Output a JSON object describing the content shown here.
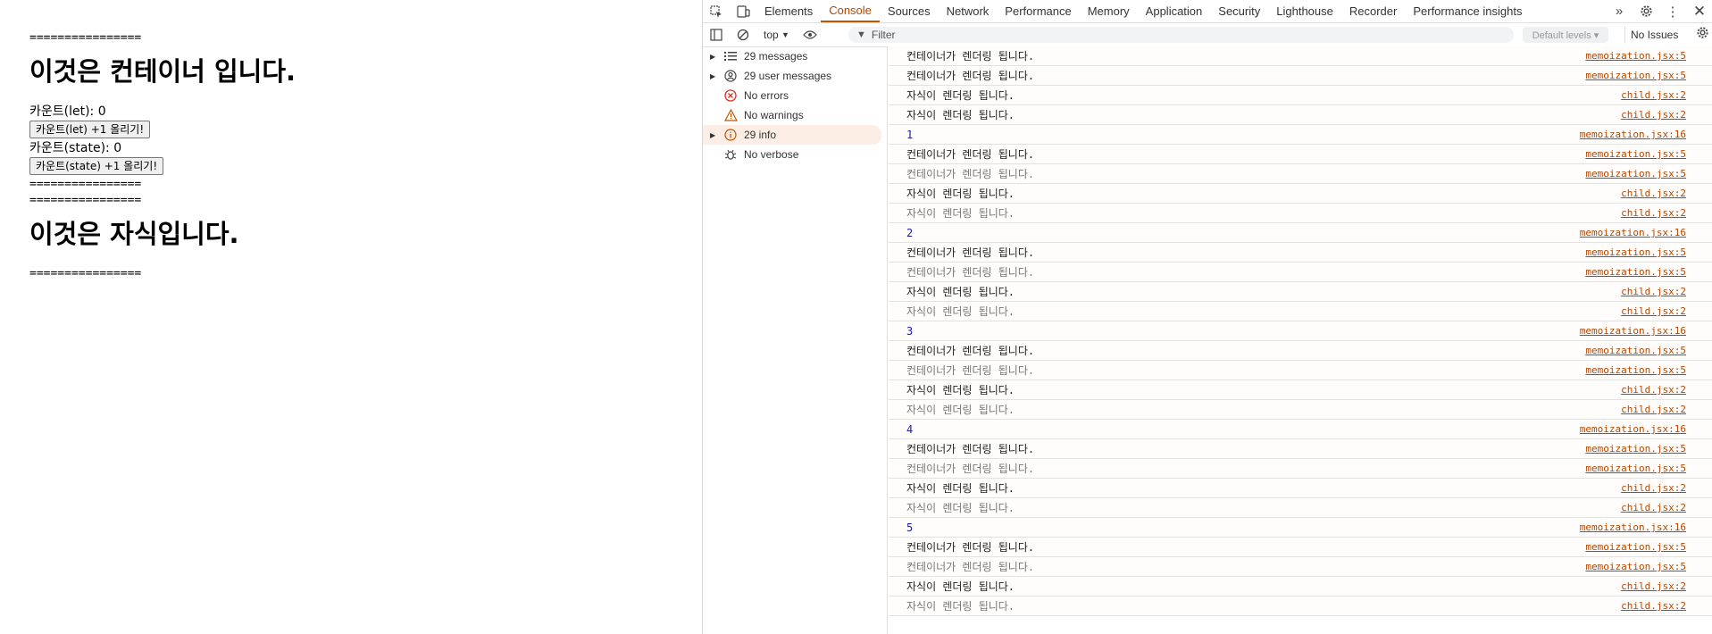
{
  "page": {
    "sep": "================",
    "container_heading": "이것은 컨테이너 입니다.",
    "count_let_label": "카운트(let): 0",
    "btn_let": "카운트(let) +1 올리기!",
    "count_state_label": "카운트(state): 0",
    "btn_state": "카운트(state) +1 올리기!",
    "child_heading": "이것은 자식입니다."
  },
  "devtools": {
    "tabs": [
      "Elements",
      "Console",
      "Sources",
      "Network",
      "Performance",
      "Memory",
      "Application",
      "Security",
      "Lighthouse",
      "Recorder",
      "Performance insights"
    ],
    "active_tab": "Console",
    "context": "top",
    "filter_placeholder": "Filter",
    "levels": "Default levels ▾",
    "issues": "No Issues",
    "sidebar": [
      {
        "label": "29 messages",
        "icon": "list-icon",
        "expandable": true
      },
      {
        "label": "29 user messages",
        "icon": "user-icon",
        "expandable": true
      },
      {
        "label": "No errors",
        "icon": "error-icon",
        "expandable": false
      },
      {
        "label": "No warnings",
        "icon": "warning-icon",
        "expandable": false
      },
      {
        "label": "29 info",
        "icon": "info-icon",
        "expandable": true
      },
      {
        "label": "No verbose",
        "icon": "bug-icon",
        "expandable": false
      }
    ],
    "messages": [
      {
        "text": "컨테이너가 렌더링 됩니다.",
        "src": "memoization.jsx:5",
        "style": "normal"
      },
      {
        "text": "컨테이너가 렌더링 됩니다.",
        "src": "memoization.jsx:5",
        "style": "normal"
      },
      {
        "text": "자식이 렌더링 됩니다.",
        "src": "child.jsx:2",
        "style": "normal"
      },
      {
        "text": "자식이 렌더링 됩니다.",
        "src": "child.jsx:2",
        "style": "normal"
      },
      {
        "text": "1",
        "src": "memoization.jsx:16",
        "style": "num"
      },
      {
        "text": "컨테이너가 렌더링 됩니다.",
        "src": "memoization.jsx:5",
        "style": "normal"
      },
      {
        "text": "컨테이너가 렌더링 됩니다.",
        "src": "memoization.jsx:5",
        "style": "dim"
      },
      {
        "text": "자식이 렌더링 됩니다.",
        "src": "child.jsx:2",
        "style": "normal"
      },
      {
        "text": "자식이 렌더링 됩니다.",
        "src": "child.jsx:2",
        "style": "dim"
      },
      {
        "text": "2",
        "src": "memoization.jsx:16",
        "style": "num"
      },
      {
        "text": "컨테이너가 렌더링 됩니다.",
        "src": "memoization.jsx:5",
        "style": "normal"
      },
      {
        "text": "컨테이너가 렌더링 됩니다.",
        "src": "memoization.jsx:5",
        "style": "dim"
      },
      {
        "text": "자식이 렌더링 됩니다.",
        "src": "child.jsx:2",
        "style": "normal"
      },
      {
        "text": "자식이 렌더링 됩니다.",
        "src": "child.jsx:2",
        "style": "dim"
      },
      {
        "text": "3",
        "src": "memoization.jsx:16",
        "style": "num"
      },
      {
        "text": "컨테이너가 렌더링 됩니다.",
        "src": "memoization.jsx:5",
        "style": "normal"
      },
      {
        "text": "컨테이너가 렌더링 됩니다.",
        "src": "memoization.jsx:5",
        "style": "dim"
      },
      {
        "text": "자식이 렌더링 됩니다.",
        "src": "child.jsx:2",
        "style": "normal"
      },
      {
        "text": "자식이 렌더링 됩니다.",
        "src": "child.jsx:2",
        "style": "dim"
      },
      {
        "text": "4",
        "src": "memoization.jsx:16",
        "style": "num"
      },
      {
        "text": "컨테이너가 렌더링 됩니다.",
        "src": "memoization.jsx:5",
        "style": "normal"
      },
      {
        "text": "컨테이너가 렌더링 됩니다.",
        "src": "memoization.jsx:5",
        "style": "dim"
      },
      {
        "text": "자식이 렌더링 됩니다.",
        "src": "child.jsx:2",
        "style": "normal"
      },
      {
        "text": "자식이 렌더링 됩니다.",
        "src": "child.jsx:2",
        "style": "dim"
      },
      {
        "text": "5",
        "src": "memoization.jsx:16",
        "style": "num"
      },
      {
        "text": "컨테이너가 렌더링 됩니다.",
        "src": "memoization.jsx:5",
        "style": "normal"
      },
      {
        "text": "컨테이너가 렌더링 됩니다.",
        "src": "memoization.jsx:5",
        "style": "dim"
      },
      {
        "text": "자식이 렌더링 됩니다.",
        "src": "child.jsx:2",
        "style": "normal"
      },
      {
        "text": "자식이 렌더링 됩니다.",
        "src": "child.jsx:2",
        "style": "dim"
      }
    ],
    "colors": {
      "accent": "#b34700",
      "row_border": "#f7dccd",
      "selected_bg": "#fdeee5"
    }
  }
}
